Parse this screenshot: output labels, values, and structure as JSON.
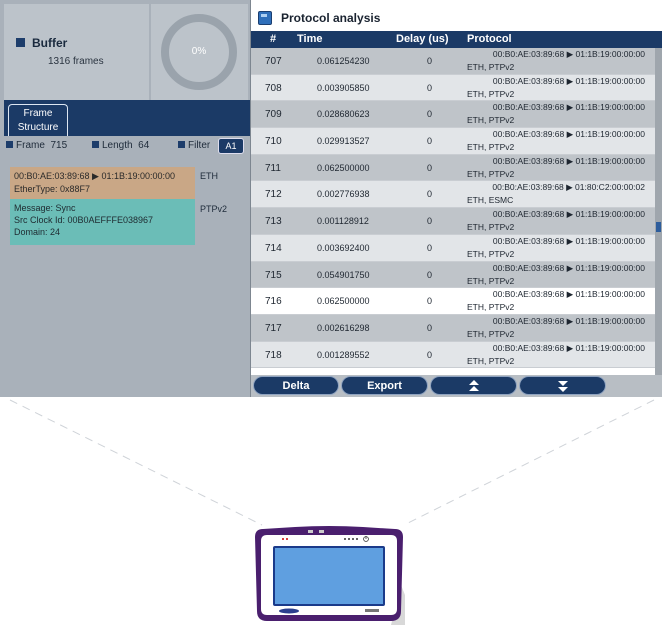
{
  "buffer": {
    "title": "Buffer",
    "frames": "1316 frames",
    "gauge": "0%"
  },
  "frame_tab": {
    "line1": "Frame",
    "line2": "Structure"
  },
  "info": {
    "frame_label": "Frame",
    "frame_value": "715",
    "length_label": "Length",
    "length_value": "64",
    "filter_label": "Filter",
    "filter_value": "A1"
  },
  "eth": {
    "line1": "00:B0:AE:03:89:68  ▶  01:1B:19:00:00:00",
    "line2": "EtherType: 0x88F7",
    "label": "ETH"
  },
  "ptp": {
    "line1": "Message: Sync",
    "line2": "Src Clock Id: 00B0AEFFFE038967",
    "line3": "Domain: 24",
    "label": "PTPv2"
  },
  "window": {
    "title": "Protocol analysis"
  },
  "table": {
    "headers": {
      "num": "#",
      "time": "Time",
      "delay": "Delay (us)",
      "protocol": "Protocol"
    },
    "rows": [
      {
        "num": "707",
        "time": "0.061254230",
        "delay": "0",
        "p1": "00:B0:AE:03:89:68 ▶ 01:1B:19:00:00:00",
        "p2": "ETH, PTPv2"
      },
      {
        "num": "708",
        "time": "0.003905850",
        "delay": "0",
        "p1": "00:B0:AE:03:89:68 ▶ 01:1B:19:00:00:00",
        "p2": "ETH, PTPv2"
      },
      {
        "num": "709",
        "time": "0.028680623",
        "delay": "0",
        "p1": "00:B0:AE:03:89:68 ▶ 01:1B:19:00:00:00",
        "p2": "ETH, PTPv2"
      },
      {
        "num": "710",
        "time": "0.029913527",
        "delay": "0",
        "p1": "00:B0:AE:03:89:68 ▶ 01:1B:19:00:00:00",
        "p2": "ETH, PTPv2"
      },
      {
        "num": "711",
        "time": "0.062500000",
        "delay": "0",
        "p1": "00:B0:AE:03:89:68 ▶ 01:1B:19:00:00:00",
        "p2": "ETH, PTPv2"
      },
      {
        "num": "712",
        "time": "0.002776938",
        "delay": "0",
        "p1": "00:B0:AE:03:89:68 ▶ 01:80:C2:00:00:02",
        "p2": "ETH, ESMC"
      },
      {
        "num": "713",
        "time": "0.001128912",
        "delay": "0",
        "p1": "00:B0:AE:03:89:68 ▶ 01:1B:19:00:00:00",
        "p2": "ETH, PTPv2"
      },
      {
        "num": "714",
        "time": "0.003692400",
        "delay": "0",
        "p1": "00:B0:AE:03:89:68 ▶ 01:1B:19:00:00:00",
        "p2": "ETH, PTPv2"
      },
      {
        "num": "715",
        "time": "0.054901750",
        "delay": "0",
        "p1": "00:B0:AE:03:89:68 ▶ 01:1B:19:00:00:00",
        "p2": "ETH, PTPv2"
      },
      {
        "num": "716",
        "time": "0.062500000",
        "delay": "0",
        "p1": "00:B0:AE:03:89:68 ▶ 01:1B:19:00:00:00",
        "p2": "ETH, PTPv2"
      },
      {
        "num": "717",
        "time": "0.002616298",
        "delay": "0",
        "p1": "00:B0:AE:03:89:68 ▶ 01:1B:19:00:00:00",
        "p2": "ETH, PTPv2"
      },
      {
        "num": "718",
        "time": "0.001289552",
        "delay": "0",
        "p1": "00:B0:AE:03:89:68 ▶ 01:1B:19:00:00:00",
        "p2": "ETH, PTPv2"
      }
    ]
  },
  "buttons": {
    "delta": "Delta",
    "export": "Export",
    "up": "⬆",
    "down": "⬇"
  },
  "icons": {
    "window": "app-window-icon",
    "up": "double-up-arrow-icon",
    "down": "double-down-arrow-icon",
    "power": "power-icon"
  },
  "colors": {
    "header_blue": "#1b3a66",
    "eth_box": "#c9a786",
    "ptp_box": "#6bbdb7",
    "device_frame": "#5a2a80",
    "device_screen": "#5f9fe0"
  }
}
